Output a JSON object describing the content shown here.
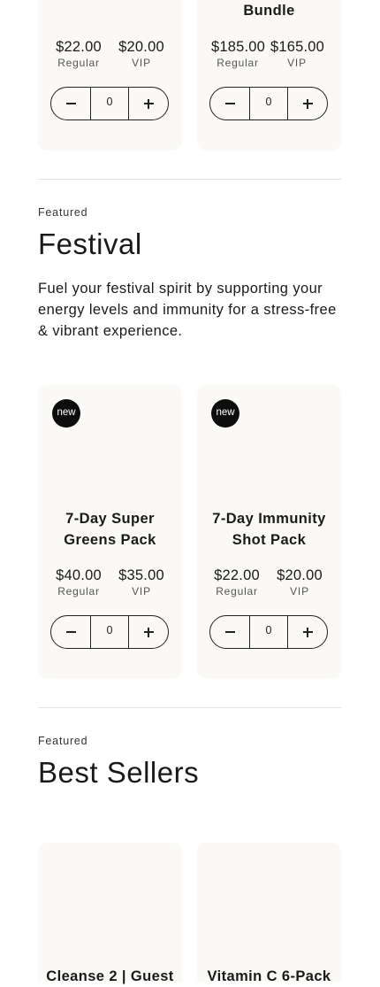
{
  "top_cards": [
    {
      "name": "",
      "regular_price": "$22.00",
      "regular_label": "Regular",
      "vip_price": "$20.00",
      "vip_label": "VIP",
      "qty": "0"
    },
    {
      "name": "Bundle",
      "regular_price": "$185.00",
      "regular_label": "Regular",
      "vip_price": "$165.00",
      "vip_label": "VIP",
      "qty": "0"
    }
  ],
  "festival": {
    "eyebrow": "Featured",
    "title": "Festival",
    "description": "Fuel your festival spirit by supporting your energy levels and immunity for a stress-free & vibrant experience.",
    "cards": [
      {
        "badge": "new",
        "name": "7-Day Super Greens Pack",
        "regular_price": "$40.00",
        "regular_label": "Regular",
        "vip_price": "$35.00",
        "vip_label": "VIP",
        "qty": "0"
      },
      {
        "badge": "new",
        "name": "7-Day Immunity Shot Pack",
        "regular_price": "$22.00",
        "regular_label": "Regular",
        "vip_price": "$20.00",
        "vip_label": "VIP",
        "qty": "0"
      }
    ]
  },
  "best_sellers": {
    "eyebrow": "Featured",
    "title": "Best Sellers",
    "cards": [
      {
        "name": "Cleanse 2 | Guest"
      },
      {
        "name": "Vitamin C 6-Pack"
      }
    ]
  },
  "icons": {
    "minus": "minus-icon",
    "plus": "plus-icon"
  },
  "colors": {
    "card_bg": "#fbf9f6",
    "badge_bg": "#0d0d0d",
    "divider": "#e3e3e3",
    "text": "#1a1a1a"
  }
}
